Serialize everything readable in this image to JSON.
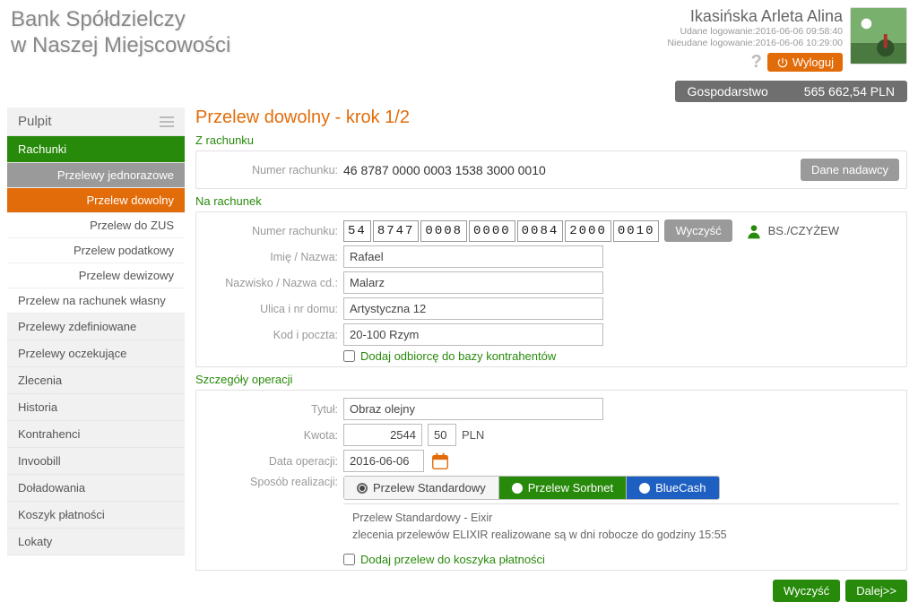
{
  "header": {
    "bank_line1": "Bank Spółdzielczy",
    "bank_line2": "w Naszej Miejscowości",
    "user_name": "Ikasińska Arleta Alina",
    "login_ok": "Udane logowanie:2016-06-06 09:58:40",
    "login_fail": "Nieudane logowanie:2016-06-06 10:29:00",
    "help": "?",
    "logout": "Wyloguj"
  },
  "account_bar": {
    "name": "Gospodarstwo",
    "balance": "565 662,54 PLN"
  },
  "sidebar": {
    "pulpit": "Pulpit",
    "rachunki": "Rachunki",
    "sub": {
      "jednorazowe": "Przelewy jednorazowe",
      "dowolny": "Przelew dowolny",
      "zus": "Przelew do ZUS",
      "podatkowy": "Przelew podatkowy",
      "dewizowy": "Przelew dewizowy",
      "wlasny": "Przelew na rachunek własny"
    },
    "items": {
      "zdefiniowane": "Przelewy zdefiniowane",
      "oczekujace": "Przelewy oczekujące",
      "zlecenia": "Zlecenia",
      "historia": "Historia",
      "kontrahenci": "Kontrahenci",
      "invoobill": "Invoobill",
      "doladowania": "Doładowania",
      "koszyk": "Koszyk płatności",
      "lokaty": "Lokaty"
    }
  },
  "content": {
    "page_title": "Przelew dowolny - krok 1/2",
    "from": {
      "section": "Z rachunku",
      "label_num": "Numer rachunku:",
      "number": "46 8787 0000 0003 1538 3000 0010",
      "sender_btn": "Dane nadawcy"
    },
    "to": {
      "section": "Na rachunek",
      "label_num": "Numer rachunku:",
      "acct_segs": [
        "54",
        "8747",
        "0008",
        "0000",
        "0084",
        "2000",
        "0010"
      ],
      "clear_btn": "Wyczyść",
      "bank_name": "BS./CZYŻEW",
      "label_name": "Imię / Nazwa:",
      "name": "Rafael",
      "label_surname": "Nazwisko / Nazwa cd.:",
      "surname": "Malarz",
      "label_street": "Ulica i nr domu:",
      "street": "Artystyczna 12",
      "label_post": "Kod i poczta:",
      "post": "20-100 Rzym",
      "add_contact": "Dodaj odbiorcę do bazy kontrahentów"
    },
    "details": {
      "section": "Szczegóły operacji",
      "label_title": "Tytuł:",
      "title": "Obraz olejny",
      "label_amount": "Kwota:",
      "amount_int": "2544",
      "amount_dec": "50",
      "currency": "PLN",
      "label_date": "Data operacji:",
      "date": "2016-06-06",
      "label_method": "Sposób realizacji:",
      "opt_std": "Przelew Standardowy",
      "opt_sorbnet": "Przelew Sorbnet",
      "opt_bluecash": "BlueCash",
      "info_title": "Przelew Standardowy - Eixir",
      "info_body": "zlecenia przelewów ELIXIR realizowane są w dni robocze do godziny 15:55",
      "add_basket": "Dodaj przelew do koszyka płatności"
    },
    "footer": {
      "clear": "Wyczyść",
      "next": "Dalej>>"
    }
  }
}
